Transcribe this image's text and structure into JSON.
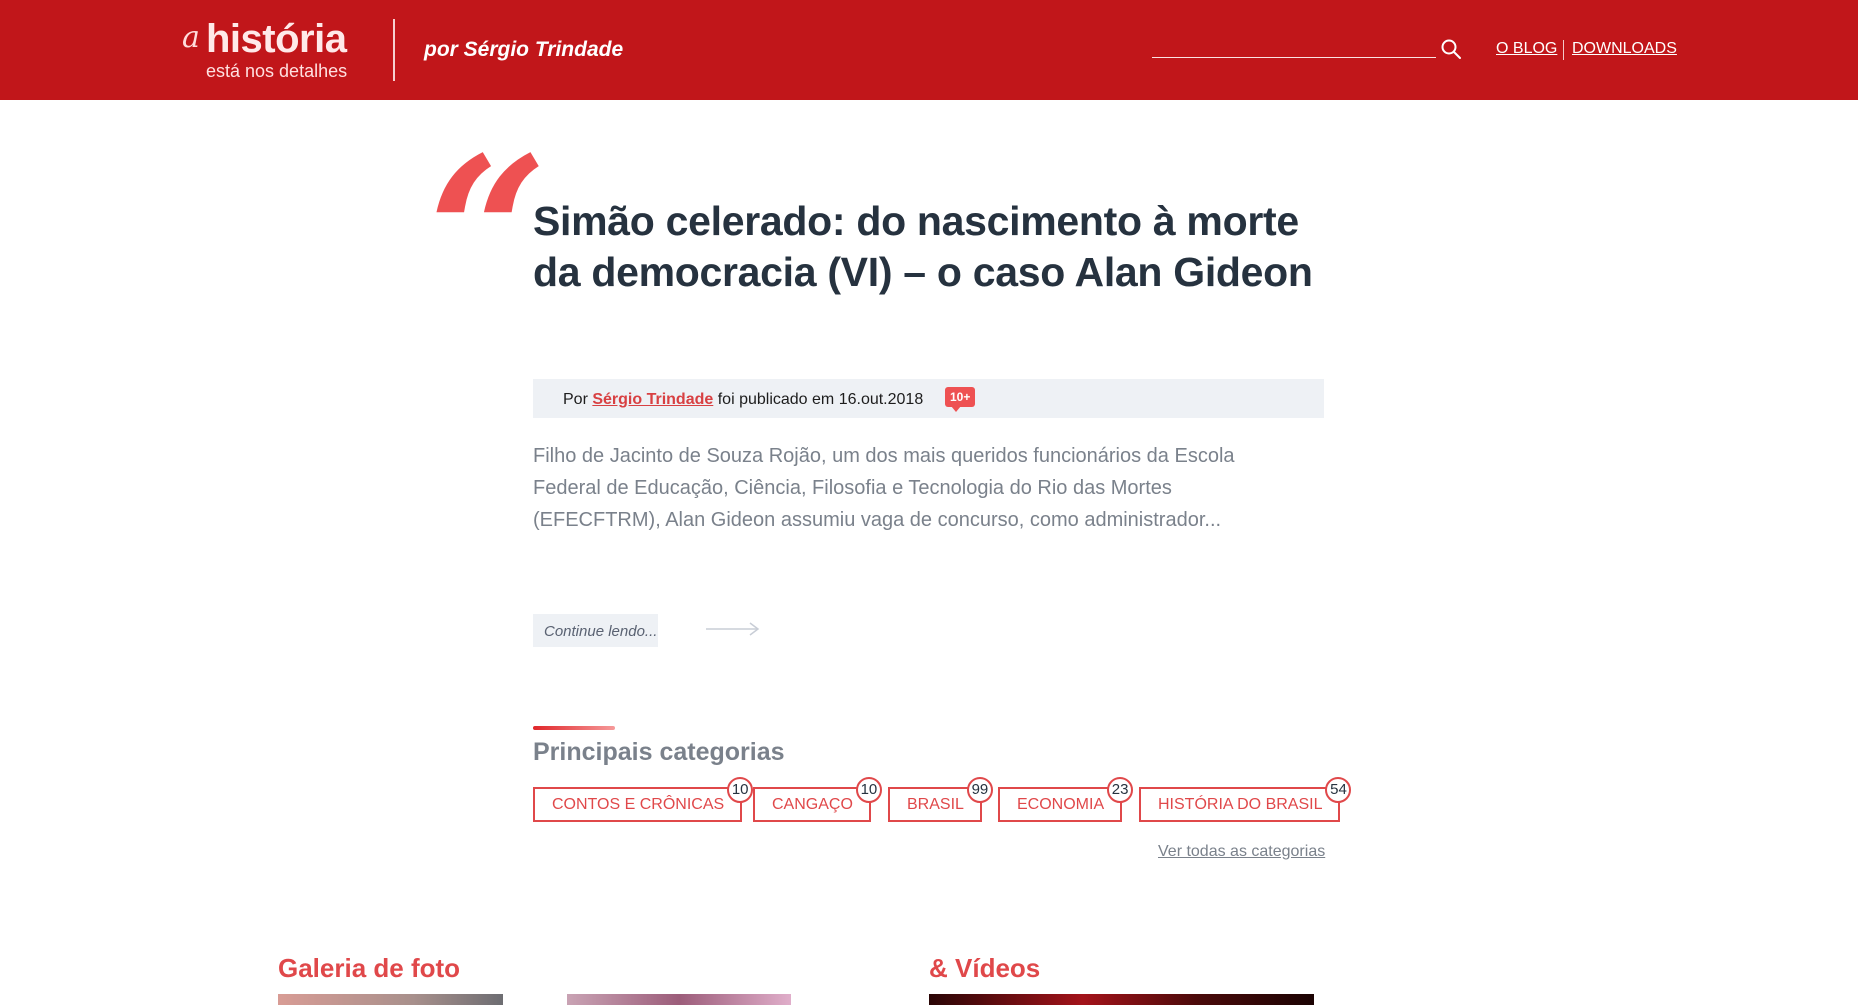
{
  "header": {
    "logo_prefix": "a",
    "logo_title": "história",
    "logo_tagline": "está nos detalhes",
    "author_tag": "por Sérgio Trindade",
    "search": {
      "value": "",
      "placeholder": ""
    },
    "nav": [
      {
        "label": "O BLOG"
      },
      {
        "label": "DOWNLOADS"
      }
    ],
    "colors": {
      "bar": "#c1161a"
    }
  },
  "article": {
    "quote_glyph": "“",
    "title": "Simão celerado: do nascimento à morte da democracia (VI) – o caso Alan Gideon",
    "meta": {
      "by": "Por",
      "author": "Sérgio Trindade",
      "published_text": "foi publicado em 16.out.2018",
      "comments_badge": "10+"
    },
    "excerpt": "Filho de Jacinto de Souza Rojão, um dos mais queridos funcionários da Escola Federal de Educação, Ciência, Filosofia e Tecnologia do Rio das Mortes (EFECFTRM), Alan Gideon assumiu vaga de concurso, como administrador...",
    "continue_label": "Continue lendo...",
    "continue_icon": "arrow-right-icon"
  },
  "categories": {
    "heading": "Principais categorias",
    "items": [
      {
        "label": "CONTOS E CRÔNICAS",
        "count": "10"
      },
      {
        "label": "CANGAÇO",
        "count": "10"
      },
      {
        "label": "BRASIL",
        "count": "99"
      },
      {
        "label": "ECONOMIA",
        "count": "23"
      },
      {
        "label": "HISTÓRIA DO BRASIL",
        "count": "54"
      }
    ],
    "see_all": "Ver todas as categorias",
    "accent_color": "#e0484a"
  },
  "sections": {
    "gallery_title": "Galeria de foto",
    "videos_title": "& Vídeos"
  }
}
